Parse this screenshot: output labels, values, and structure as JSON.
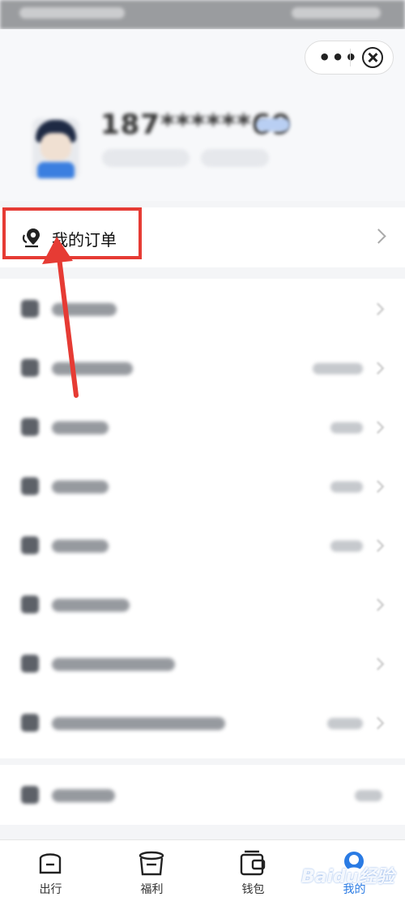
{
  "profile": {
    "phone": "187******69"
  },
  "order": {
    "label": "我的订单"
  },
  "menu_rows": [
    {
      "label_width": 80,
      "value_width": 0,
      "chevron": true
    },
    {
      "label_width": 100,
      "value_width": 62,
      "chevron": true
    },
    {
      "label_width": 70,
      "value_width": 40,
      "chevron": true
    },
    {
      "label_width": 70,
      "value_width": 40,
      "chevron": true
    },
    {
      "label_width": 70,
      "value_width": 40,
      "chevron": true
    },
    {
      "label_width": 96,
      "value_width": 0,
      "chevron": true
    },
    {
      "label_width": 152,
      "value_width": 0,
      "chevron": true
    },
    {
      "label_width": 214,
      "value_width": 44,
      "chevron": true
    }
  ],
  "tabs": [
    {
      "label": "出行",
      "icon": "face-box-icon"
    },
    {
      "label": "福利",
      "icon": "pot-icon"
    },
    {
      "label": "钱包",
      "icon": "wallet-icon"
    },
    {
      "label": "我的",
      "icon": "avatar-icon"
    }
  ],
  "watermark": "Baidu经验",
  "colors": {
    "highlight": "#e63b34",
    "accent": "#2a7be4"
  }
}
